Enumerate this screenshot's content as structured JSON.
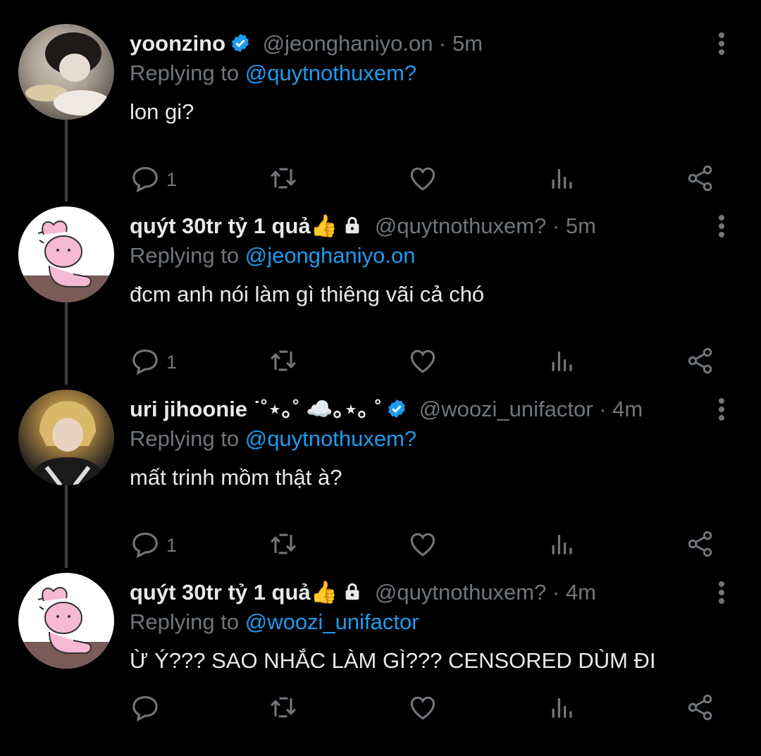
{
  "colors": {
    "background": "#000000",
    "text": "#e7e9ea",
    "muted": "#71767b",
    "accent": "#1d9bf0",
    "verified": "#1d9bf0",
    "thread_line": "#3b3f44"
  },
  "tweets": [
    {
      "name": "yoonzino",
      "verified": true,
      "handle": "@jeonghaniyo.on",
      "sep": " · ",
      "time": "5m",
      "replying_prefix": "Replying to ",
      "replying_to": "@quytnothuxem?",
      "text": "lon gi?",
      "reply_count": "1",
      "avatar_icon": "photo-avatar"
    },
    {
      "name": "quýt 30tr tỷ 1 quả👍",
      "locked": true,
      "handle": "@quytnothuxem?",
      "sep": " · ",
      "time": "5m",
      "replying_prefix": "Replying to ",
      "replying_to": "@jeonghaniyo.on",
      "text": "đcm anh nói làm gì thiêng vãi cả chó",
      "reply_count": "1",
      "avatar_icon": "pink-rabbit-avatar"
    },
    {
      "name": "uri jihoonie ˙˚⋆｡˚ ☁️｡⋆｡ ˚",
      "verified": true,
      "handle": "@woozi_unifactor",
      "sep": " · ",
      "time": "4m",
      "replying_prefix": "Replying to ",
      "replying_to": "@quytnothuxem?",
      "text": "mất trinh mồm thật à?",
      "reply_count": "1",
      "avatar_icon": "photo-avatar"
    },
    {
      "name": "quýt 30tr tỷ 1 quả👍",
      "locked": true,
      "handle": "@quytnothuxem?",
      "sep": " · ",
      "time": "4m",
      "replying_prefix": "Replying to ",
      "replying_to": "@woozi_unifactor",
      "text": "Ừ Ý??? SAO NHẮC LÀM GÌ??? CENSORED DÙM ĐI",
      "reply_count": "",
      "avatar_icon": "pink-rabbit-avatar"
    }
  ],
  "action_icons": [
    "reply-icon",
    "retweet-icon",
    "like-icon",
    "analytics-icon",
    "share-icon"
  ]
}
